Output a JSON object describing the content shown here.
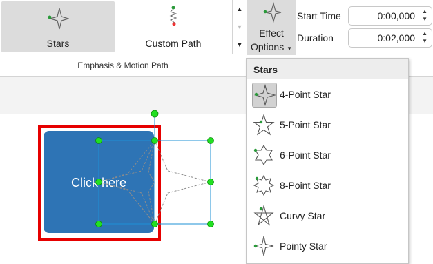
{
  "ribbon": {
    "stars_label": "Stars",
    "custom_path_label": "Custom Path",
    "effect_options_line1": "Effect",
    "effect_options_line2": "Options",
    "start_time_label": "Start Time",
    "start_time_value": "0:00,000",
    "duration_label": "Duration",
    "duration_value": "0:02,000",
    "group_label": "Emphasis & Motion Path"
  },
  "slide": {
    "shape_text": "Click here"
  },
  "menu": {
    "header": "Stars",
    "items": [
      {
        "label": "4-Point Star",
        "icon": "four-point-star-icon",
        "selected": true
      },
      {
        "label": "5-Point Star",
        "icon": "five-point-star-icon",
        "selected": false
      },
      {
        "label": "6-Point Star",
        "icon": "six-point-star-icon",
        "selected": false
      },
      {
        "label": "8-Point Star",
        "icon": "eight-point-star-icon",
        "selected": false
      },
      {
        "label": "Curvy Star",
        "icon": "curvy-star-icon",
        "selected": false
      },
      {
        "label": "Pointy Star",
        "icon": "pointy-star-icon",
        "selected": false
      }
    ]
  },
  "colors": {
    "shape_fill": "#2e74b5",
    "highlight_border": "#e60000",
    "handle": "#22e022",
    "path_frame": "#1e90d6"
  }
}
